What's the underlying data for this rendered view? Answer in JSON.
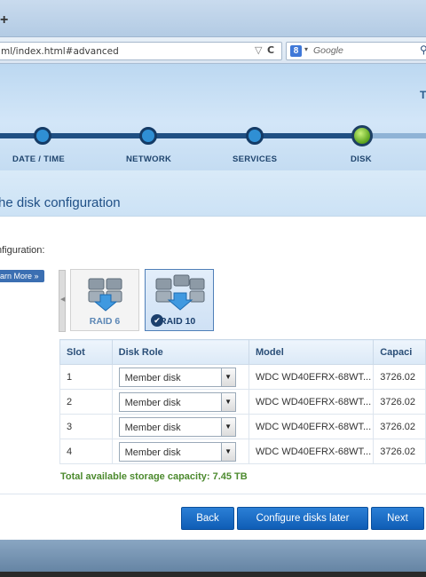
{
  "browser": {
    "url": "ml/index.html#advanced",
    "search_placeholder": "Google",
    "search_engine_letter": "8",
    "new_tab": "+"
  },
  "wizard": {
    "header_letter": "T",
    "steps": [
      {
        "label": "DATE / TIME"
      },
      {
        "label": "NETWORK"
      },
      {
        "label": "SERVICES"
      },
      {
        "label": "DISK"
      }
    ],
    "section_title": "he disk configuration",
    "config_label": "nfiguration:",
    "learn_more": "arn More »",
    "raid_options": [
      {
        "label": "RAID 6",
        "selected": false
      },
      {
        "label": "RAID 10",
        "selected": true
      }
    ]
  },
  "table": {
    "columns": [
      "Slot",
      "Disk Role",
      "Model",
      "Capaci"
    ],
    "rows": [
      {
        "slot": "1",
        "role": "Member disk",
        "model": "WDC WD40EFRX-68WT...",
        "capacity": "3726.02"
      },
      {
        "slot": "2",
        "role": "Member disk",
        "model": "WDC WD40EFRX-68WT...",
        "capacity": "3726.02"
      },
      {
        "slot": "3",
        "role": "Member disk",
        "model": "WDC WD40EFRX-68WT...",
        "capacity": "3726.02"
      },
      {
        "slot": "4",
        "role": "Member disk",
        "model": "WDC WD40EFRX-68WT...",
        "capacity": "3726.02"
      }
    ]
  },
  "total_capacity": "Total available storage capacity: 7.45 TB",
  "buttons": {
    "back": "Back",
    "configure_later": "Configure disks later",
    "next": "Next"
  },
  "colors": {
    "accent": "#1f4f86",
    "button": "#1a6bc4",
    "capacity_text": "#4c8a2e",
    "active_step": "#5aa21c"
  }
}
